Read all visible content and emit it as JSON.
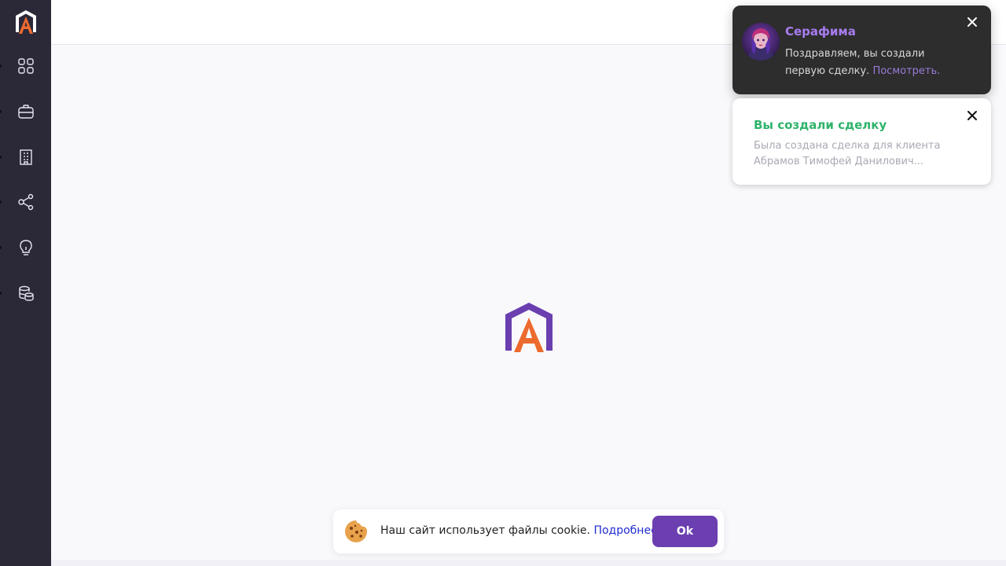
{
  "sidebar": {
    "items": [
      {
        "icon": "apps-grid-icon"
      },
      {
        "icon": "briefcase-icon"
      },
      {
        "icon": "building-icon"
      },
      {
        "icon": "share-network-icon"
      },
      {
        "icon": "lightbulb-icon"
      },
      {
        "icon": "database-coins-icon"
      }
    ]
  },
  "notifications": {
    "assistant": {
      "title": "Серафима",
      "text": "Поздравляем, вы создали первую сделку.",
      "link": "Посмотреть."
    },
    "deal": {
      "title": "Вы создали сделку",
      "text": "Была создана сделка для клиента Абрамов Тимофей Данилович..."
    }
  },
  "cookie_banner": {
    "text": "Наш сайт использует файлы cookie.",
    "link": "Подробнее",
    "button": "Ok"
  },
  "colors": {
    "sidebar": "#2b2838",
    "brand_purple": "#6b3fb0",
    "brand_orange": "#ec6a2e",
    "success_green": "#2fb36b"
  }
}
